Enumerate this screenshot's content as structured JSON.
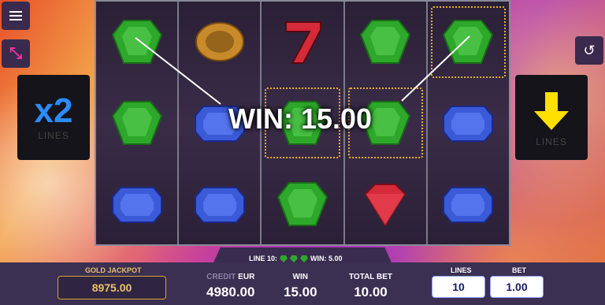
{
  "win_banner": "WIN: 15.00",
  "multiplier_panel": {
    "value": "x2",
    "label": "LINES"
  },
  "lines_panel": {
    "label": "LINES"
  },
  "reels": [
    [
      "green-emerald",
      "green-emerald",
      "blue-sapphire"
    ],
    [
      "topaz",
      "blue-sapphire",
      "blue-sapphire"
    ],
    [
      "red-seven",
      "green-emerald",
      "green-emerald"
    ],
    [
      "green-emerald",
      "green-emerald",
      "red-ruby"
    ],
    [
      "green-emerald",
      "blue-sapphire",
      "blue-sapphire"
    ]
  ],
  "line_info": {
    "line": "LINE 10:",
    "win": "WIN: 5.00"
  },
  "jackpot": {
    "label": "GOLD JACKPOT",
    "value": "8975.00"
  },
  "credit": {
    "label": "CREDIT",
    "currency": "EUR",
    "value": "4980.00"
  },
  "win": {
    "label": "WIN",
    "value": "15.00"
  },
  "total_bet": {
    "label": "TOTAL BET",
    "value": "10.00"
  },
  "lines": {
    "label": "LINES",
    "value": "10"
  },
  "bet": {
    "label": "BET",
    "value": "1.00"
  },
  "colors": {
    "emerald": "#2ea82a",
    "sapphire": "#3a5ad8",
    "ruby": "#d42a3a",
    "topaz": "#c88a2a",
    "jackpot_gold": "#e8c26a",
    "accent_blue": "#2a8cff",
    "arrow_yellow": "#ffe000"
  }
}
